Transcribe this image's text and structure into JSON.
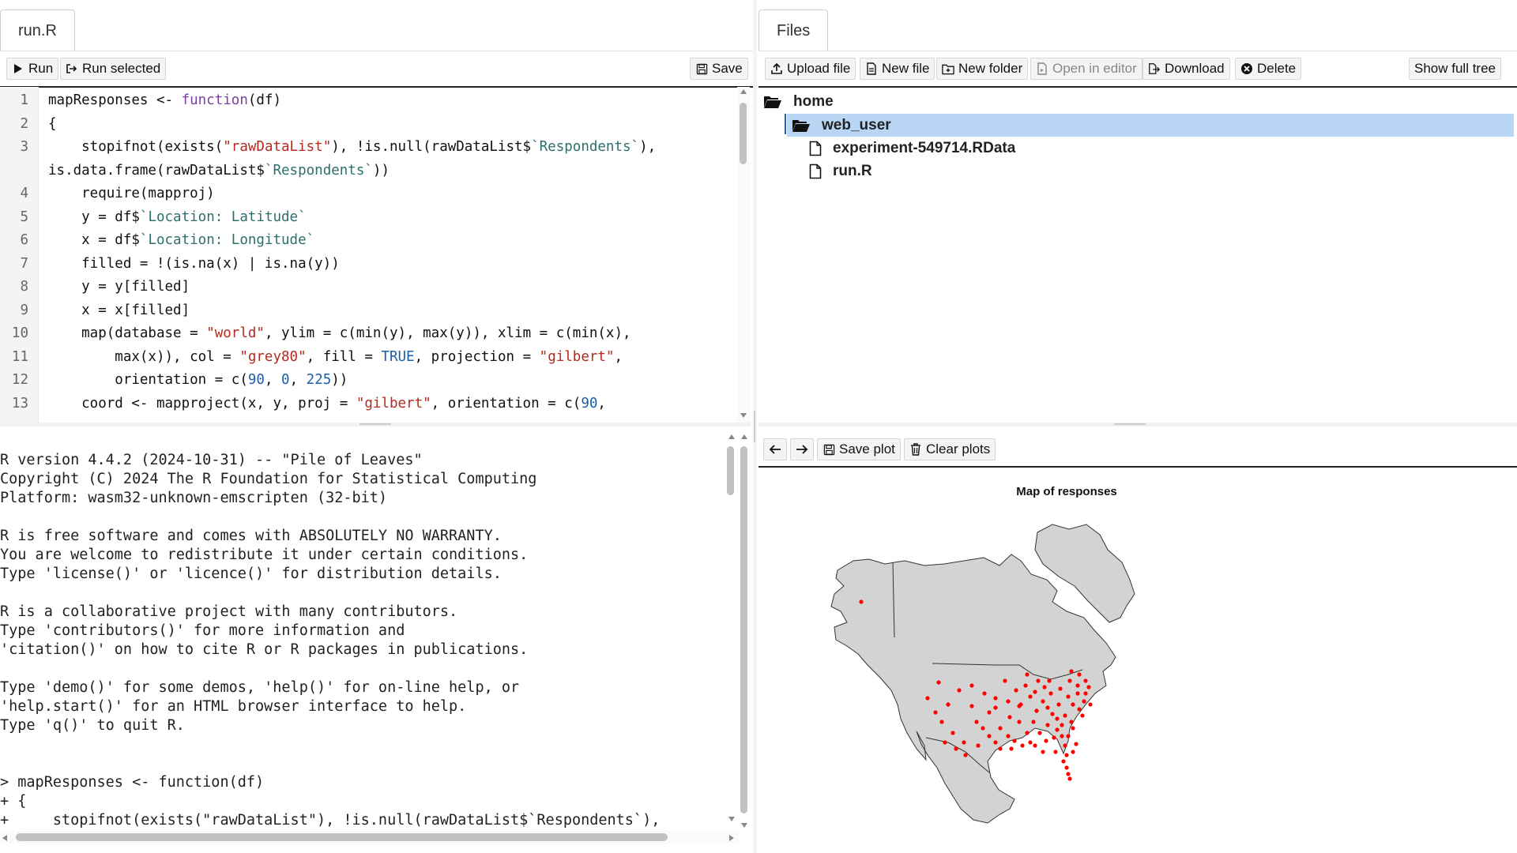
{
  "editor": {
    "tab_label": "run.R",
    "run_label": "Run",
    "run_selected_label": "Run selected",
    "save_label": "Save",
    "lines": [
      {
        "num": "1",
        "tokens": [
          {
            "t": "mapResponses <- "
          },
          {
            "t": "function",
            "c": "kw"
          },
          {
            "t": "(df)"
          }
        ]
      },
      {
        "num": "2",
        "tokens": [
          {
            "t": "{"
          }
        ]
      },
      {
        "num": "3",
        "tokens": [
          {
            "t": "    stopifnot(exists("
          },
          {
            "t": "\"rawDataList\"",
            "c": "str"
          },
          {
            "t": "), !is.null(rawDataList$"
          },
          {
            "t": "`Respondents`",
            "c": "bt"
          },
          {
            "t": "),"
          }
        ]
      },
      {
        "num": "",
        "tokens": [
          {
            "t": "is.data.frame(rawDataList$"
          },
          {
            "t": "`Respondents`",
            "c": "bt"
          },
          {
            "t": "))"
          }
        ]
      },
      {
        "num": "4",
        "tokens": [
          {
            "t": "    require(mapproj)"
          }
        ]
      },
      {
        "num": "5",
        "tokens": [
          {
            "t": "    y = df$"
          },
          {
            "t": "`Location: Latitude`",
            "c": "bt"
          }
        ]
      },
      {
        "num": "6",
        "tokens": [
          {
            "t": "    x = df$"
          },
          {
            "t": "`Location: Longitude`",
            "c": "bt"
          }
        ]
      },
      {
        "num": "7",
        "tokens": [
          {
            "t": "    filled = !(is.na(x) | is.na(y))"
          }
        ]
      },
      {
        "num": "8",
        "tokens": [
          {
            "t": "    y = y[filled]"
          }
        ]
      },
      {
        "num": "9",
        "tokens": [
          {
            "t": "    x = x[filled]"
          }
        ]
      },
      {
        "num": "10",
        "tokens": [
          {
            "t": "    map(database = "
          },
          {
            "t": "\"world\"",
            "c": "str"
          },
          {
            "t": ", ylim = c(min(y), max(y)), xlim = c(min(x),"
          }
        ]
      },
      {
        "num": "11",
        "tokens": [
          {
            "t": "        max(x)), col = "
          },
          {
            "t": "\"grey80\"",
            "c": "str"
          },
          {
            "t": ", fill = "
          },
          {
            "t": "TRUE",
            "c": "num"
          },
          {
            "t": ", projection = "
          },
          {
            "t": "\"gilbert\"",
            "c": "str"
          },
          {
            "t": ","
          }
        ]
      },
      {
        "num": "12",
        "tokens": [
          {
            "t": "        orientation = c("
          },
          {
            "t": "90",
            "c": "num"
          },
          {
            "t": ", "
          },
          {
            "t": "0",
            "c": "num"
          },
          {
            "t": ", "
          },
          {
            "t": "225",
            "c": "num"
          },
          {
            "t": "))"
          }
        ]
      },
      {
        "num": "13",
        "tokens": [
          {
            "t": "    coord <- mapproject(x, y, proj = "
          },
          {
            "t": "\"gilbert\"",
            "c": "str"
          },
          {
            "t": ", orientation = c("
          },
          {
            "t": "90",
            "c": "num"
          },
          {
            "t": ","
          }
        ]
      }
    ]
  },
  "console": {
    "lines": [
      "R version 4.4.2 (2024-10-31) -- \"Pile of Leaves\"",
      "Copyright (C) 2024 The R Foundation for Statistical Computing",
      "Platform: wasm32-unknown-emscripten (32-bit)",
      "",
      "R is free software and comes with ABSOLUTELY NO WARRANTY.",
      "You are welcome to redistribute it under certain conditions.",
      "Type 'license()' or 'licence()' for distribution details.",
      "",
      "R is a collaborative project with many contributors.",
      "Type 'contributors()' for more information and",
      "'citation()' on how to cite R or R packages in publications.",
      "",
      "Type 'demo()' for some demos, 'help()' for on-line help, or",
      "'help.start()' for an HTML browser interface to help.",
      "Type 'q()' to quit R.",
      "",
      "",
      "> mapResponses <- function(df)",
      "+ {",
      "+     stopifnot(exists(\"rawDataList\"), !is.null(rawDataList$`Respondents`),"
    ]
  },
  "files": {
    "tab_label": "Files",
    "toolbar": {
      "upload": "Upload file",
      "new_file": "New file",
      "new_folder": "New folder",
      "open_in_editor": "Open in editor",
      "download": "Download",
      "delete": "Delete",
      "show_full_tree": "Show full tree"
    },
    "tree": {
      "root": "home",
      "selected_folder": "web_user",
      "files": [
        "experiment-549714.RData",
        "run.R"
      ]
    }
  },
  "plots": {
    "save_plot": "Save plot",
    "clear_plots": "Clear plots",
    "title": "Map of responses",
    "land_color": "#d3d3d3",
    "point_color": "#ff0000",
    "selection_color": "#b9d7f5"
  }
}
